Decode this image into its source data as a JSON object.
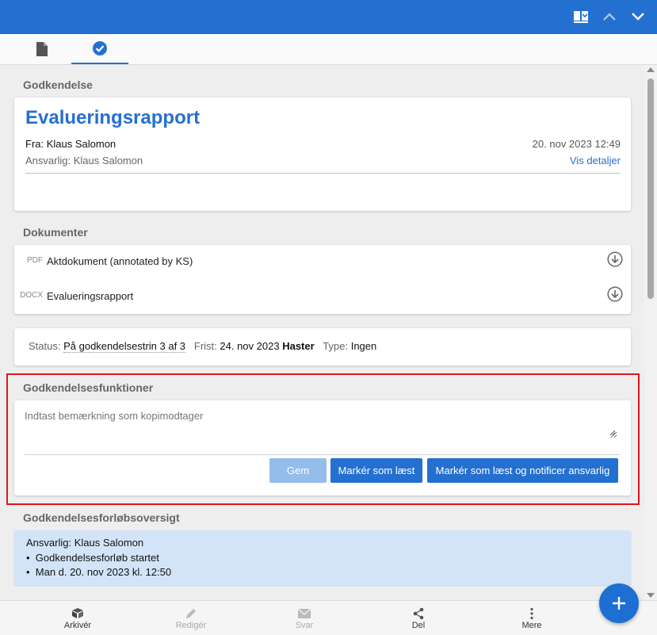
{
  "colors": {
    "accent": "#2470d1",
    "highlight_border": "#e0161b",
    "overview_bg": "#d3e4f9"
  },
  "topbar": {
    "icons": [
      "book-open-icon",
      "chevron-up-icon",
      "chevron-down-icon"
    ]
  },
  "tabs": [
    {
      "icon": "document-icon",
      "active": false
    },
    {
      "icon": "check-circle-icon",
      "active": true
    }
  ],
  "approval": {
    "section_title": "Godkendelse",
    "title": "Evalueringsrapport",
    "from": "Fra: Klaus Salomon",
    "date": "20. nov 2023 12:49",
    "responsible": "Ansvarlig: Klaus Salomon",
    "details_link": "Vis detaljer"
  },
  "documents": {
    "section_title": "Dokumenter",
    "items": [
      {
        "type": "PDF",
        "name": "Aktdokument (annotated by KS)"
      },
      {
        "type": "DOCX",
        "name": "Evalueringsrapport"
      }
    ]
  },
  "status": {
    "status_label": "Status:",
    "status_value": "På godkendelsestrin 3 af 3",
    "deadline_label": "Frist:",
    "deadline_value": "24. nov 2023",
    "urgent": "Haster",
    "type_label": "Type:",
    "type_value": "Ingen"
  },
  "functions": {
    "section_title": "Godkendelsesfunktioner",
    "comment_placeholder": "Indtast bemærkning som kopimodtager",
    "save_button": "Gem",
    "mark_read_button": "Markér som læst",
    "mark_read_notify_button": "Markér som læst og notificer ansvarlig"
  },
  "overview": {
    "section_title": "Godkendelsesforløbsoversigt",
    "responsible": "Ansvarlig: Klaus Salomon",
    "bullets": [
      "Godkendelsesforløb startet",
      "Man d. 20. nov 2023 kl. 12:50"
    ]
  },
  "bottom_nav": {
    "archive": "Arkivér",
    "edit": "Redigér",
    "reply": "Svar",
    "share": "Del",
    "more": "Mere"
  },
  "fab": {
    "icon": "plus-icon"
  }
}
